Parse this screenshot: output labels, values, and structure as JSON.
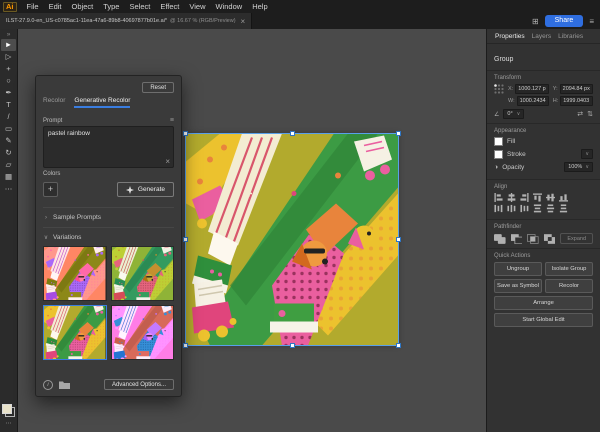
{
  "menubar": {
    "logo": "Ai",
    "items": [
      "File",
      "Edit",
      "Object",
      "Type",
      "Select",
      "Effect",
      "View",
      "Window",
      "Help"
    ]
  },
  "tabbar": {
    "doc_title": "ILST-27.9.0-en_US-c0785ac1-11ea-47a6-89b8-40697877b01e.ai*",
    "zoom_info": "@ 16.67 % (RGB/Preview)",
    "close_glyph": "×"
  },
  "topright": {
    "workspace_glyph": "⊞",
    "share_label": "Share",
    "panel_menu_glyph": "≡"
  },
  "toolbar": {
    "tools": [
      {
        "name": "tools-overflow",
        "glyph": "»"
      },
      {
        "name": "selection-tool",
        "glyph": "►"
      },
      {
        "name": "direct-selection-tool",
        "glyph": "▷"
      },
      {
        "name": "magic-wand-tool",
        "glyph": "+"
      },
      {
        "name": "lasso-tool",
        "glyph": "○"
      },
      {
        "name": "pen-tool",
        "glyph": "✒"
      },
      {
        "name": "type-tool",
        "glyph": "T"
      },
      {
        "name": "line-segment-tool",
        "glyph": "/"
      },
      {
        "name": "rectangle-tool",
        "glyph": "▭"
      },
      {
        "name": "paintbrush-tool",
        "glyph": "✎"
      },
      {
        "name": "rotate-tool",
        "glyph": "↻"
      },
      {
        "name": "scale-tool",
        "glyph": "▱"
      },
      {
        "name": "mesh-tool",
        "glyph": "▦"
      },
      {
        "name": "more-tools",
        "glyph": "⋯"
      }
    ],
    "edit_toolbar_glyph": "⋯"
  },
  "recolor_panel": {
    "tab_recolor": "Recolor",
    "tab_generative": "Generative Recolor",
    "reset_label": "Reset",
    "prompt_label": "Prompt",
    "prompt_menu_glyph": "≡",
    "prompt_value": "pastel rainbow",
    "clear_glyph": "×",
    "colors_label": "Colors",
    "add_glyph": "+",
    "generate_label": "Generate",
    "sample_prompts_chevron": "›",
    "sample_prompts_label": "Sample Prompts",
    "variations_chevron": "∨",
    "variations_label": "Variations",
    "selected_variation": 3,
    "info_glyph": "i",
    "advanced_label": "Advanced Options..."
  },
  "properties_panel": {
    "tabs": [
      {
        "label": "Properties"
      },
      {
        "label": "Layers"
      },
      {
        "label": "Libraries"
      }
    ],
    "selection_type": "Group",
    "transform": {
      "title": "Transform",
      "x_label": "X:",
      "x_value": "1000.127 p",
      "y_label": "Y:",
      "y_value": "2094.84 px",
      "w_label": "W:",
      "w_value": "1000.2434",
      "h_label": "H:",
      "h_value": "1999.0403",
      "angle_glyph": "∠",
      "angle_value": "0°",
      "flip_h_glyph": "⇄",
      "flip_v_glyph": "⇅"
    },
    "appearance": {
      "title": "Appearance",
      "fill_label": "Fill",
      "stroke_label": "Stroke",
      "opacity_glyph": "◑",
      "opacity_label": "Opacity",
      "opacity_value": "100%"
    },
    "align": {
      "title": "Align"
    },
    "pathfinder": {
      "title": "Pathfinder",
      "expand_label": "Expand"
    },
    "quick_actions": {
      "title": "Quick Actions",
      "buttons": [
        "Ungroup",
        "Isolate Group",
        "Save as Symbol",
        "Recolor",
        "Arrange",
        "Start Global Edit"
      ]
    }
  },
  "colors": {
    "accent_blue": "#3a7de0",
    "share_blue": "#2f6ee0",
    "canvas_gray": "#4a4a4a",
    "panel_gray": "#323232",
    "selection_outline": "#58a0ea"
  },
  "artwork_palette": {
    "background": "#b2aa2d",
    "green": "#3c9b44",
    "dark_green": "#2e8238",
    "yellow": "#ecc22e",
    "pink": "#ea5f9f",
    "magenta": "#e0457c",
    "orange": "#e8843c",
    "cream": "#f3ecd2"
  }
}
